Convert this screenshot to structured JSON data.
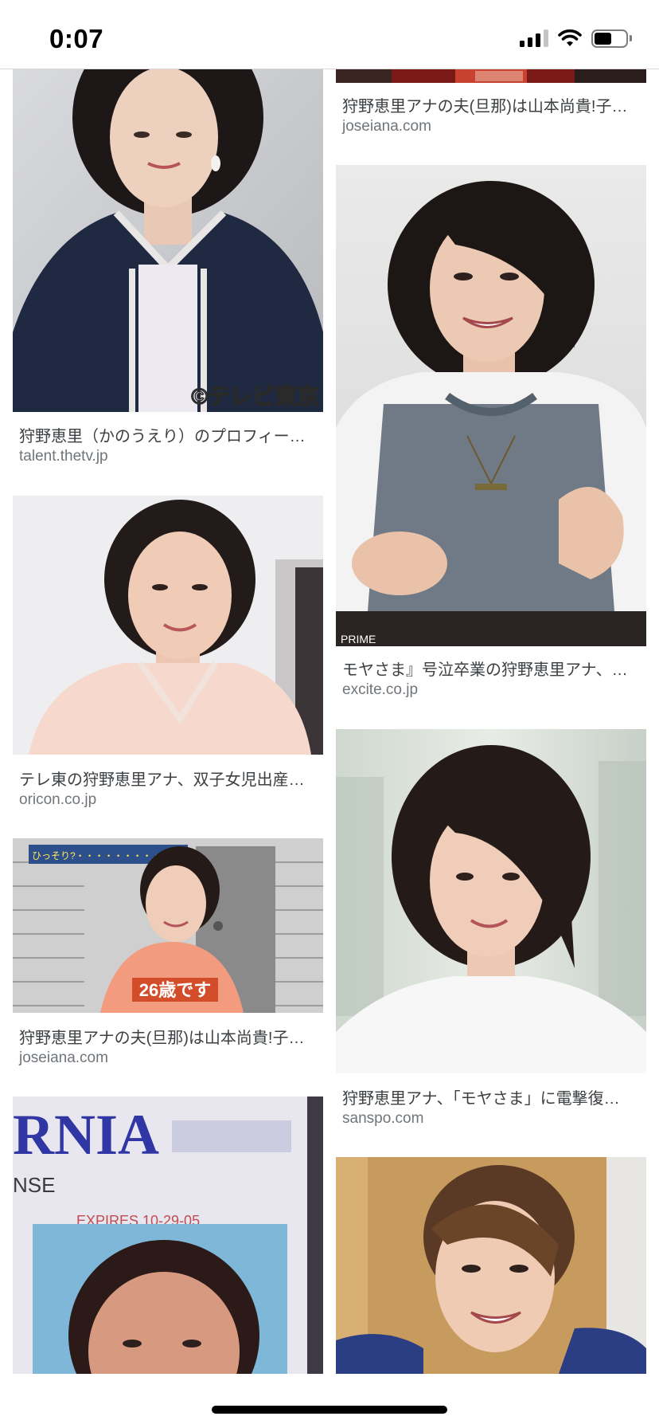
{
  "status_bar": {
    "time": "0:07",
    "icons": [
      "cellular-signal-icon",
      "wifi-icon",
      "battery-icon"
    ],
    "battery_level": 0.55
  },
  "results": {
    "left": [
      {
        "watermark": "©テレビ東京",
        "title": "狩野恵里（かのうえり）のプロフィー…",
        "domain": "talent.thetv.jp"
      },
      {
        "title": "テレ東の狩野恵里アナ、双子女児出産…",
        "domain": "oricon.co.jp"
      },
      {
        "overlay_text": "26歳です",
        "title": "狩野恵里アナの夫(旦那)は山本尚貴!子…",
        "domain": "joseiana.com"
      },
      {
        "overlay_text": "RNIA",
        "overlay_text_2": "NSE",
        "overlay_text_3": "EXPIRES 10-29-05",
        "title": "",
        "domain": ""
      }
    ],
    "right": [
      {
        "title": "狩野恵里アナの夫(旦那)は山本尚貴!子…",
        "domain": "joseiana.com"
      },
      {
        "watermark": "PRIME",
        "title": "モヤさま』号泣卒業の狩野恵里アナ、…",
        "domain": "excite.co.jp"
      },
      {
        "title": "狩野恵里アナ、「モヤさま」に電撃復…",
        "domain": "sanspo.com"
      },
      {
        "title": "",
        "domain": ""
      }
    ]
  },
  "colors": {
    "background": "#ffffff",
    "title_text": "#3c4043",
    "domain_text": "#70757a"
  }
}
